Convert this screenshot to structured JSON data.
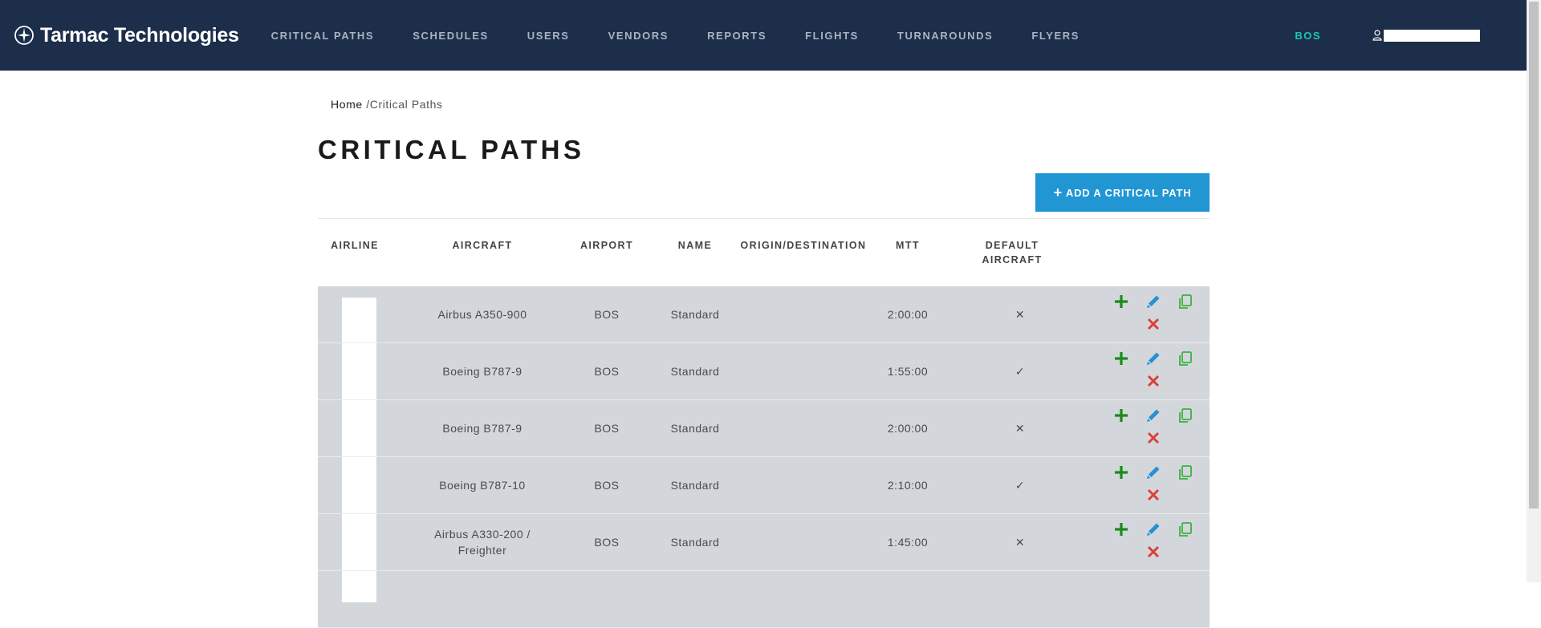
{
  "nav": {
    "brand": "Tarmac Technologies",
    "links": [
      "CRITICAL PATHS",
      "SCHEDULES",
      "USERS",
      "VENDORS",
      "REPORTS",
      "FLIGHTS",
      "TURNAROUNDS",
      "FLYERS"
    ],
    "airport": "BOS"
  },
  "breadcrumb": {
    "home": "Home",
    "sep": "/",
    "current": "Critical Paths"
  },
  "page": {
    "title": "CRITICAL PATHS",
    "add_button": "ADD A CRITICAL PATH"
  },
  "table": {
    "headers": {
      "airline": "AIRLINE",
      "aircraft": "AIRCRAFT",
      "airport": "AIRPORT",
      "name": "NAME",
      "origin": "ORIGIN/DESTINATION",
      "mtt": "MTT",
      "default1": "DEFAULT",
      "default2": "AIRCRAFT"
    },
    "rows": [
      {
        "aircraft": "Airbus A350-900",
        "airport": "BOS",
        "name": "Standard",
        "origin": "",
        "mtt": "2:00:00",
        "default": "✕"
      },
      {
        "aircraft": "Boeing B787-9",
        "airport": "BOS",
        "name": "Standard",
        "origin": "",
        "mtt": "1:55:00",
        "default": "✓"
      },
      {
        "aircraft": "Boeing B787-9",
        "airport": "BOS",
        "name": "Standard",
        "origin": "",
        "mtt": "2:00:00",
        "default": "✕"
      },
      {
        "aircraft": "Boeing B787-10",
        "airport": "BOS",
        "name": "Standard",
        "origin": "",
        "mtt": "2:10:00",
        "default": "✓"
      },
      {
        "aircraft": "Airbus A330-200 / Freighter",
        "airport": "BOS",
        "name": "Standard",
        "origin": "",
        "mtt": "1:45:00",
        "default": "✕"
      }
    ]
  },
  "colors": {
    "navbar": "#1c2e4a",
    "accent": "#1fc6b2",
    "button": "#2196d3",
    "row_bg": "#d3d7db",
    "add_icon": "#1a8a1a",
    "edit_icon": "#2a8fd6",
    "delete_icon": "#d9413a",
    "copy_icon": "#3cb043"
  },
  "icons": {
    "brand": "airplane-compass-icon",
    "user": "user-icon",
    "add": "plus-icon",
    "edit": "pencil-icon",
    "delete": "close-icon",
    "copy": "copy-icon"
  }
}
